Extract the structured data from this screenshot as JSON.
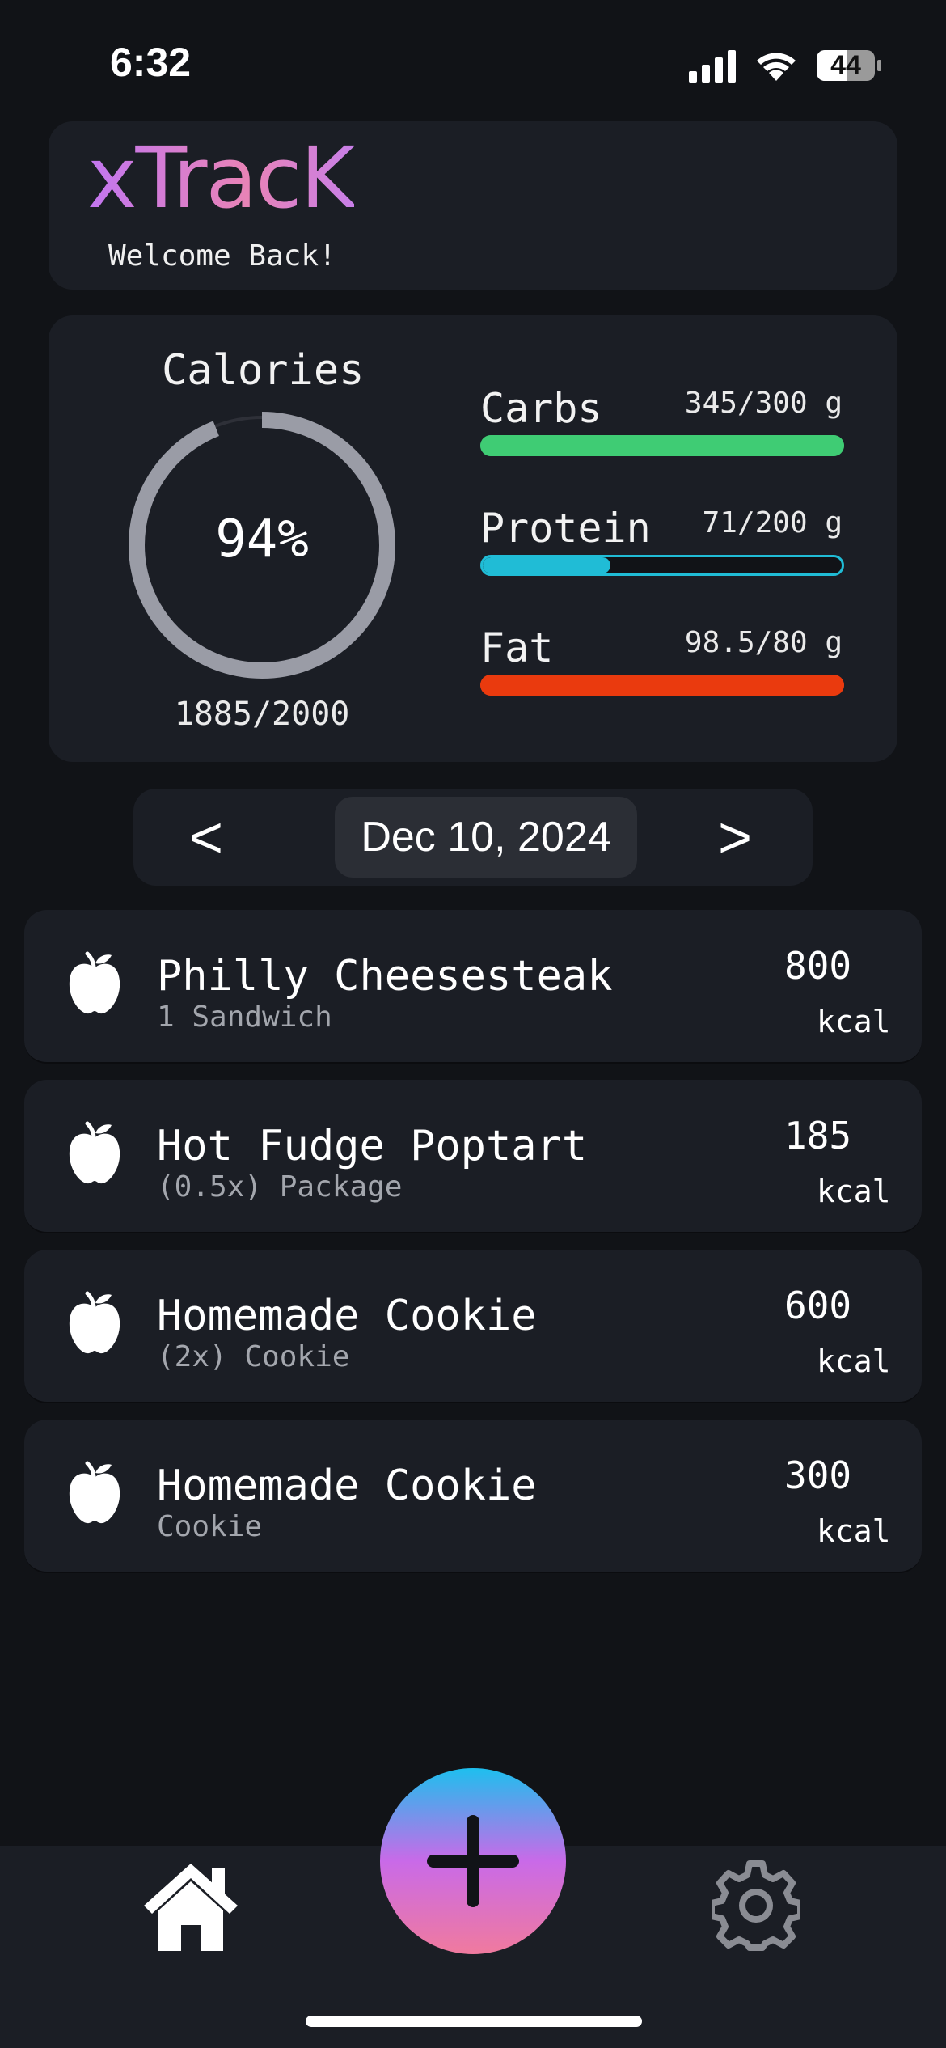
{
  "status_bar": {
    "time": "6:32",
    "battery": "44"
  },
  "header": {
    "app_title": "xTracK",
    "welcome": "Welcome Back!"
  },
  "calories": {
    "title": "Calories",
    "percent_label": "94%",
    "progress": 0.94,
    "count": "1885/2000"
  },
  "macros": [
    {
      "name": "Carbs",
      "value": "345/300 g",
      "progress": 1.0,
      "color": "#3fcc74"
    },
    {
      "name": "Protein",
      "value": "71/200 g",
      "progress": 0.355,
      "color": "#20bcd6"
    },
    {
      "name": "Fat",
      "value": "98.5/80 g",
      "progress": 1.0,
      "color": "#ea3a0e"
    }
  ],
  "date_nav": {
    "prev": "<",
    "date": "Dec 10, 2024",
    "next": ">"
  },
  "foods": [
    {
      "name": "Philly Cheesesteak",
      "serving": "1 Sandwich",
      "kcal": "800",
      "unit": "kcal",
      "icon": "apple-icon"
    },
    {
      "name": "Hot Fudge Poptart",
      "serving": "(0.5x) Package",
      "kcal": "185",
      "unit": "kcal",
      "icon": "apple-icon"
    },
    {
      "name": "Homemade Cookie",
      "serving": "(2x) Cookie",
      "kcal": "600",
      "unit": "kcal",
      "icon": "apple-icon"
    },
    {
      "name": "Homemade Cookie",
      "serving": "Cookie",
      "kcal": "300",
      "unit": "kcal",
      "icon": "apple-icon"
    }
  ],
  "tabbar": {
    "home_icon": "home-icon",
    "add_icon": "plus-icon",
    "settings_icon": "gear-icon"
  },
  "colors": {
    "background": "#111317",
    "card": "#1b1e25",
    "ring": "#9a9ca6"
  }
}
